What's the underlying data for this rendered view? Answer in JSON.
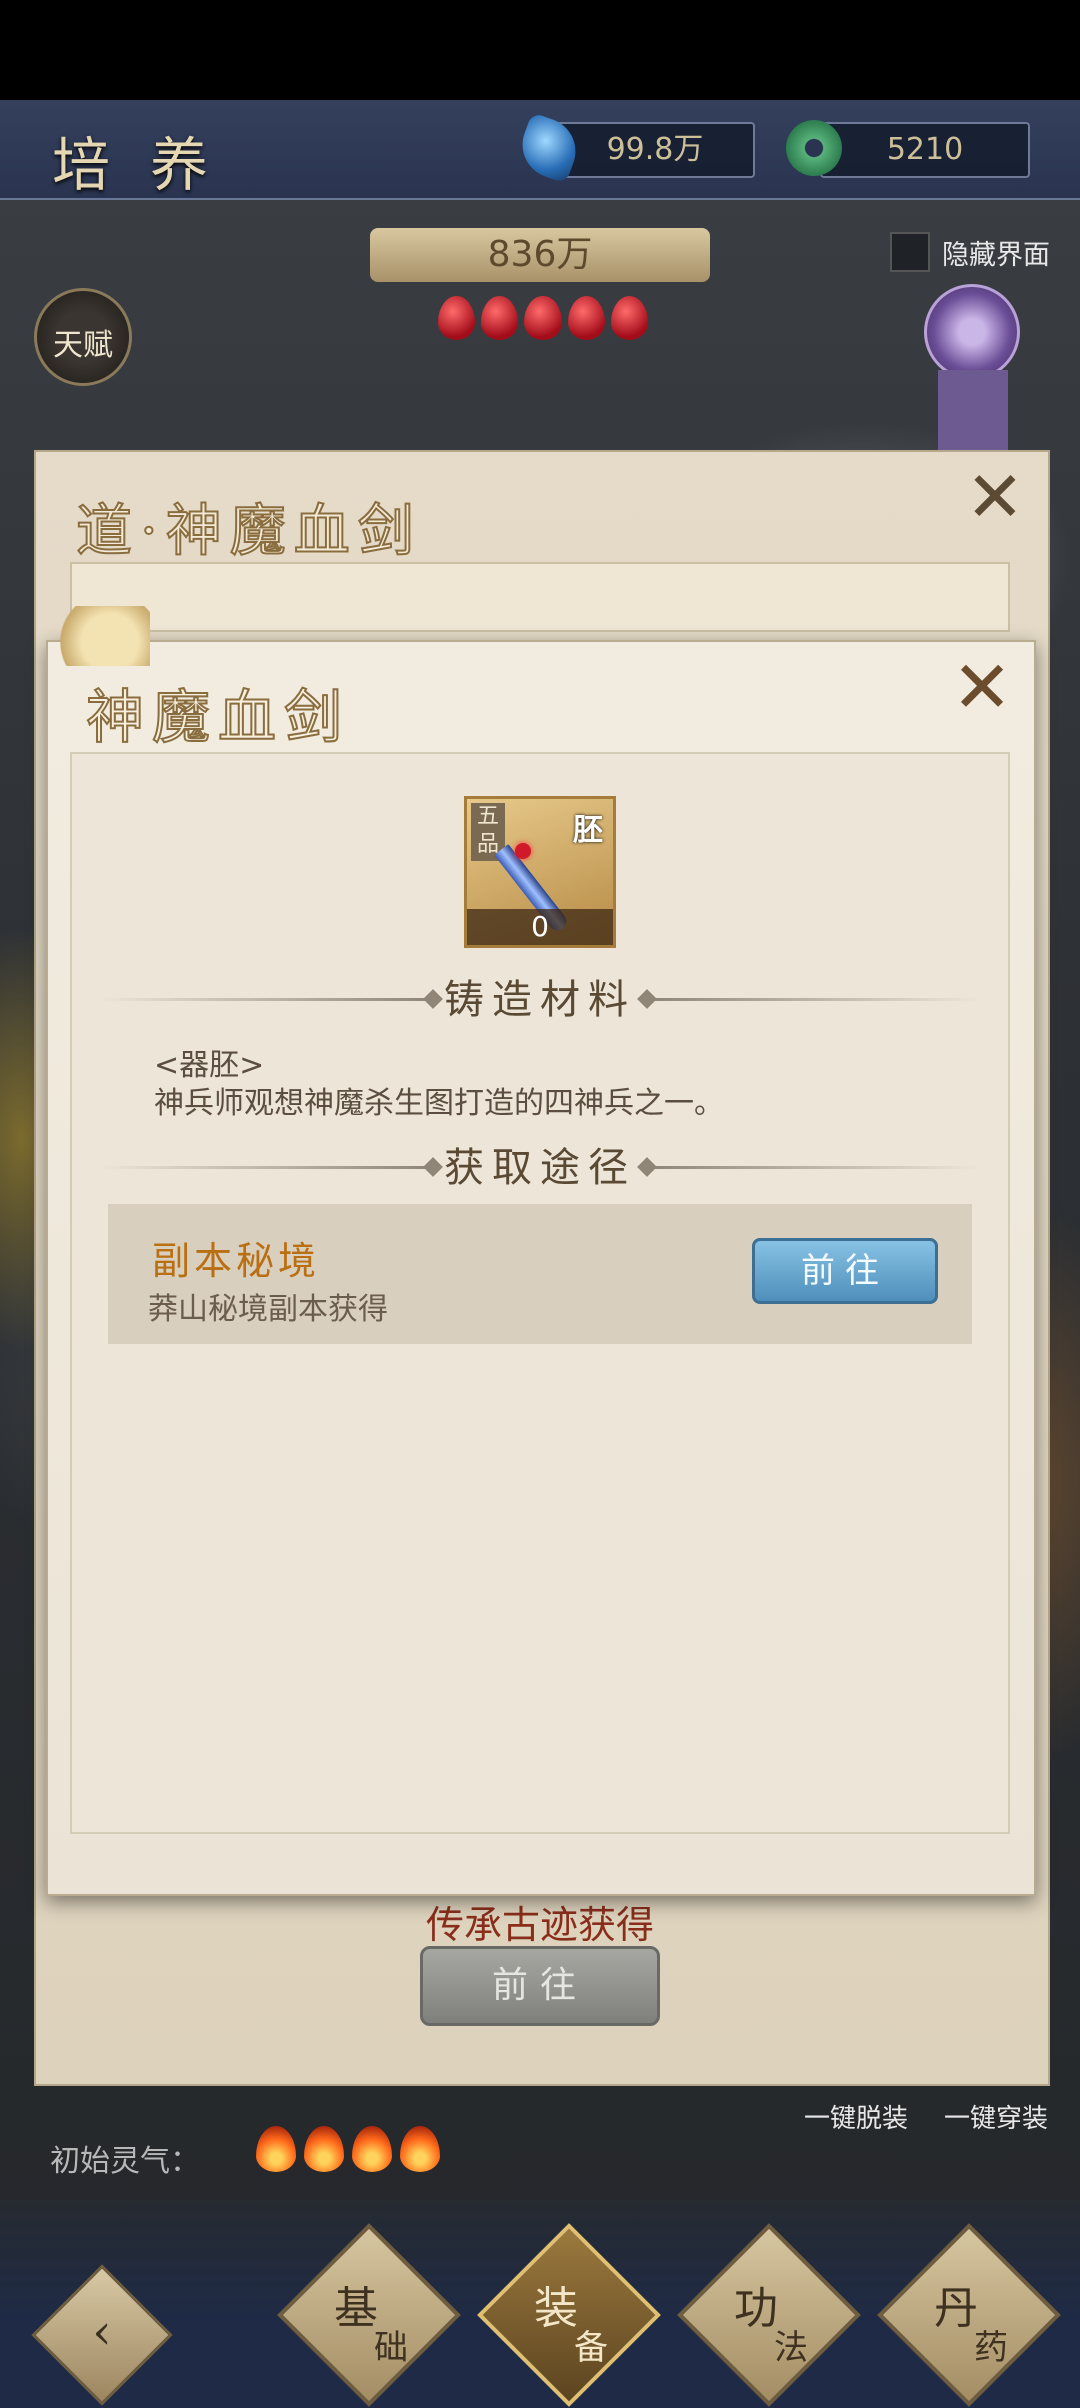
{
  "header": {
    "title": "培养",
    "crystal_value": "99.8万",
    "jade_value": "5210",
    "power_value": "836万",
    "hide_ui_label": "隐藏界面",
    "talent_label": "天赋"
  },
  "back_dialog": {
    "title": "道·神魔血剑",
    "bottom_source": "传承古迹获得",
    "goto_label": "前往",
    "unequip_all": "一键脱装",
    "equip_all": "一键穿装"
  },
  "qi": {
    "label": "初始灵气：",
    "flames": 4
  },
  "bottom_nav": [
    {
      "l1": "基",
      "l2": "础"
    },
    {
      "l1": "装",
      "l2": "备"
    },
    {
      "l1": "功",
      "l2": "法"
    },
    {
      "l1": "丹",
      "l2": "药"
    }
  ],
  "dialog": {
    "title": "神魔血剑",
    "item": {
      "grade": "五品",
      "type": "胚",
      "count": "0"
    },
    "section_material": "铸造材料",
    "material_tag": "<器胚>",
    "material_desc": "神兵师观想神魔杀生图打造的四神兵之一。",
    "section_source": "获取途径",
    "route": {
      "name": "副本秘境",
      "desc": "莽山秘境副本获得",
      "goto_label": "前往"
    }
  },
  "colors": {
    "route_name": "#b96f12",
    "goto_blue": "#4f8fbb",
    "bottom_source": "#8a2e1c"
  }
}
